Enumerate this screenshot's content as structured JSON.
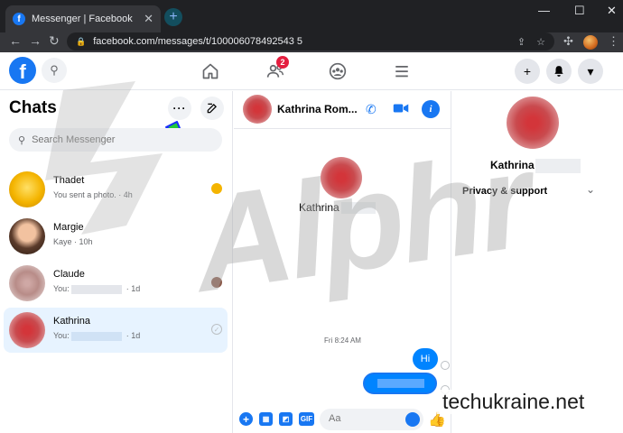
{
  "browser": {
    "tab_title": "Messenger | Facebook",
    "tab_favicon": "f",
    "close_glyph": "✕",
    "newtab_glyph": "+",
    "minimize_glyph": "—",
    "maximize_glyph": "☐",
    "close_window_glyph": "✕",
    "back_glyph": "←",
    "forward_glyph": "→",
    "reload_glyph": "↻",
    "url": "facebook.com/messages/t/100006078492543 5",
    "menu_glyph": "⋮"
  },
  "fb_header": {
    "logo_letter": "f",
    "search_glyph": "⚲",
    "friends_badge": "2",
    "create_glyph": "+",
    "notifications_glyph": "🔔",
    "account_glyph": "▾"
  },
  "chats": {
    "title": "Chats",
    "more_glyph": "···",
    "search_placeholder": "Search Messenger",
    "search_glyph": "⚲",
    "items": [
      {
        "name": "Thadet",
        "preview": "You sent a photo.",
        "time": "· 4h"
      },
      {
        "name": "Margie",
        "preview": "Kaye",
        "time": "· 10h"
      },
      {
        "name": "Claude",
        "preview": "You:",
        "time": "· 1d"
      },
      {
        "name": "Kathrina",
        "preview": "You:",
        "time": "· 1d"
      }
    ],
    "check_glyph": "✓"
  },
  "conversation": {
    "header_name": "Kathrina Rom...",
    "phone_glyph": "✆",
    "video_glyph": "▶",
    "info_glyph": "i",
    "profile_name": "Kathrina",
    "timestamp": "Fri 8:24 AM",
    "message_hi": "Hi",
    "composer_placeholder": "Aa",
    "plus_glyph": "+",
    "gif_label": "GIF",
    "like_glyph": "👍"
  },
  "details": {
    "name": "Kathrina",
    "privacy_label": "Privacy & support",
    "chevron_glyph": "⌄"
  },
  "watermarks": {
    "brand_text": "Alphr",
    "site_text": "techukraine.net"
  }
}
